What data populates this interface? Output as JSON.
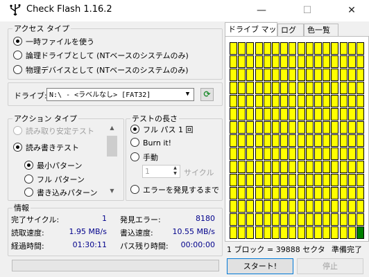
{
  "window": {
    "title": "Check Flash 1.16.2",
    "minimize": "—",
    "maximize": "☐",
    "close": "✕"
  },
  "access": {
    "legend": "アクセス タイプ",
    "options": [
      "一時ファイルを使う",
      "論理ドライブとして (NTベースのシステムのみ)",
      "物理デバイスとして (NTベースのシステムのみ)"
    ],
    "selected": 0
  },
  "drive": {
    "label": "ドライブ:",
    "value": "N:\\ - <ラベルなし> [FAT32]",
    "refresh": "2"
  },
  "action": {
    "legend": "アクション タイプ",
    "items": [
      "読み取り安定テスト",
      "読み書きテスト"
    ],
    "patterns": [
      "最小パターン",
      "フル パターン",
      "書き込みパターン"
    ]
  },
  "length": {
    "legend": "テストの長さ",
    "options": [
      "フル パス 1 回",
      "Burn it!",
      "手動"
    ],
    "cycles_value": "1",
    "cycles_label": "サイクル",
    "until_error": "エラーを発見するまで"
  },
  "info": {
    "legend": "情報",
    "completed_cycles_label": "完了サイクル:",
    "completed_cycles": "1",
    "errors_label": "発見エラー:",
    "errors": "8180",
    "read_speed_label": "読取速度:",
    "read_speed": "1.95 MB/s",
    "write_speed_label": "書込速度:",
    "write_speed": "10.55 MB/s",
    "elapsed_label": "経過時間:",
    "elapsed": "01:30:11",
    "remaining_label": "パス残り時間:",
    "remaining": "00:00:00"
  },
  "tabs": [
    "ドライブ マップ",
    "ログ",
    "色一覧"
  ],
  "map": {
    "columns": 16,
    "rows": 15,
    "fill_color": "#ffff00",
    "done_color": "#008000",
    "border_color": "#000000",
    "done_cells": 1
  },
  "status": {
    "block_size": "1 ブロック = 39888 セクタ",
    "state": "準備完了"
  },
  "buttons": {
    "start": "スタート!",
    "stop": "停止"
  }
}
